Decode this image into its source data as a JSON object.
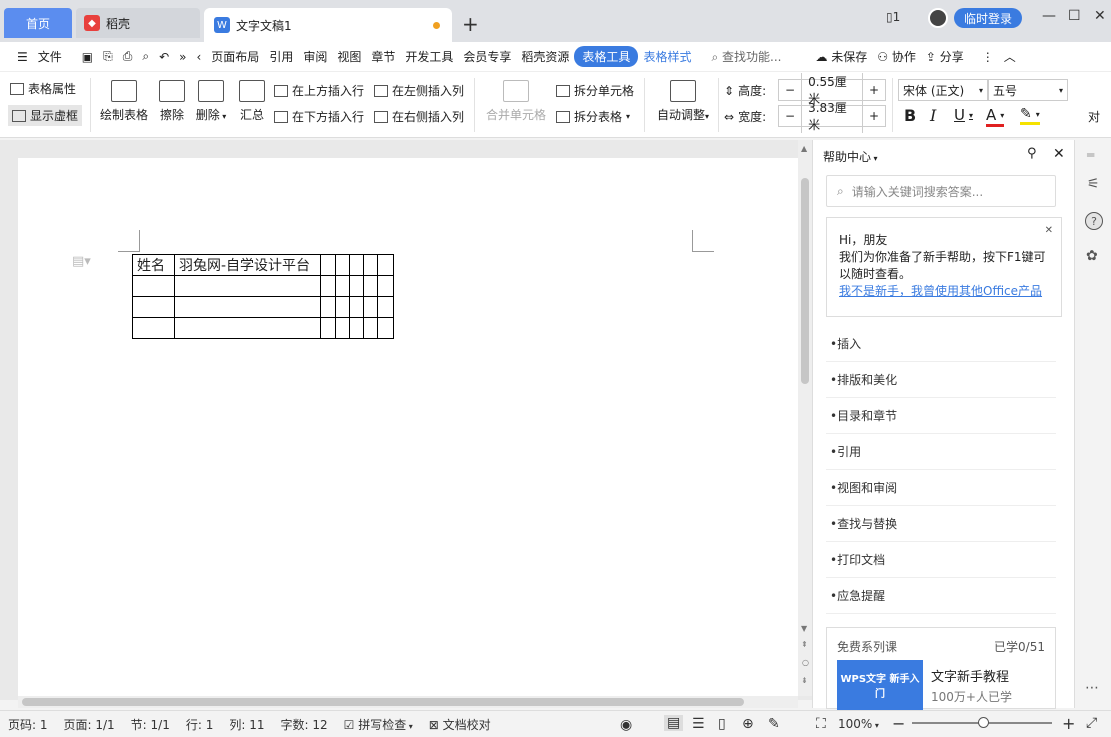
{
  "titlebar": {
    "tabs": [
      {
        "label": "首页"
      },
      {
        "label": "稻壳"
      },
      {
        "label": "文字文稿1"
      }
    ],
    "login_label": "临时登录"
  },
  "menubar": {
    "file_label": "文件",
    "items": [
      "页面布局",
      "引用",
      "审阅",
      "视图",
      "章节",
      "开发工具",
      "会员专享",
      "稻壳资源"
    ],
    "active_label": "表格工具",
    "style_label": "表格样式",
    "search_label": "查找功能...",
    "unsaved_label": "未保存",
    "collab_label": "协作",
    "share_label": "分享"
  },
  "ribbon": {
    "table_props": "表格属性",
    "show_grid": "显示虚框",
    "draw_table": "绘制表格",
    "erase": "擦除",
    "delete": "删除",
    "summary": "汇总",
    "insert_row_above": "在上方插入行",
    "insert_row_below": "在下方插入行",
    "insert_col_left": "在左侧插入列",
    "insert_col_right": "在右侧插入列",
    "merge_cells": "合并单元格",
    "split_cells": "拆分单元格",
    "split_table": "拆分表格",
    "auto_fit": "自动调整",
    "height_label": "高度:",
    "height_value": "0.55厘米",
    "width_label": "宽度:",
    "width_value": "3.83厘米",
    "font_name": "宋体 (正文)",
    "font_size": "五号",
    "align_label": "对"
  },
  "document": {
    "table": [
      [
        "姓名",
        "羽兔网-自学设计平台",
        "",
        "",
        "",
        "",
        ""
      ],
      [
        "",
        "",
        "",
        "",
        "",
        "",
        ""
      ],
      [
        "",
        "",
        "",
        "",
        "",
        "",
        ""
      ],
      [
        "",
        "",
        "",
        "",
        "",
        "",
        ""
      ]
    ]
  },
  "help": {
    "title": "帮助中心",
    "search_placeholder": "请输入关键词搜索答案...",
    "greeting": "Hi，朋友",
    "message": "我们为你准备了新手帮助，按下F1键可以随时查看。",
    "link": "我不是新手，我曾使用其他Office产品",
    "items": [
      "插入",
      "排版和美化",
      "目录和章节",
      "引用",
      "视图和审阅",
      "查找与替换",
      "打印文档",
      "应急提醒"
    ],
    "course_title": "免费系列课",
    "course_progress": "已学0/51",
    "course_thumb": "WPS文字 新手入门",
    "course_name": "文字新手教程",
    "course_sub": "100万+人已学"
  },
  "status": {
    "page_no": "页码: 1",
    "pages": "页面: 1/1",
    "section": "节: 1/1",
    "row": "行: 1",
    "col": "列: 11",
    "words": "字数: 12",
    "spell": "拼写检查",
    "proof": "文档校对",
    "zoom": "100%"
  }
}
